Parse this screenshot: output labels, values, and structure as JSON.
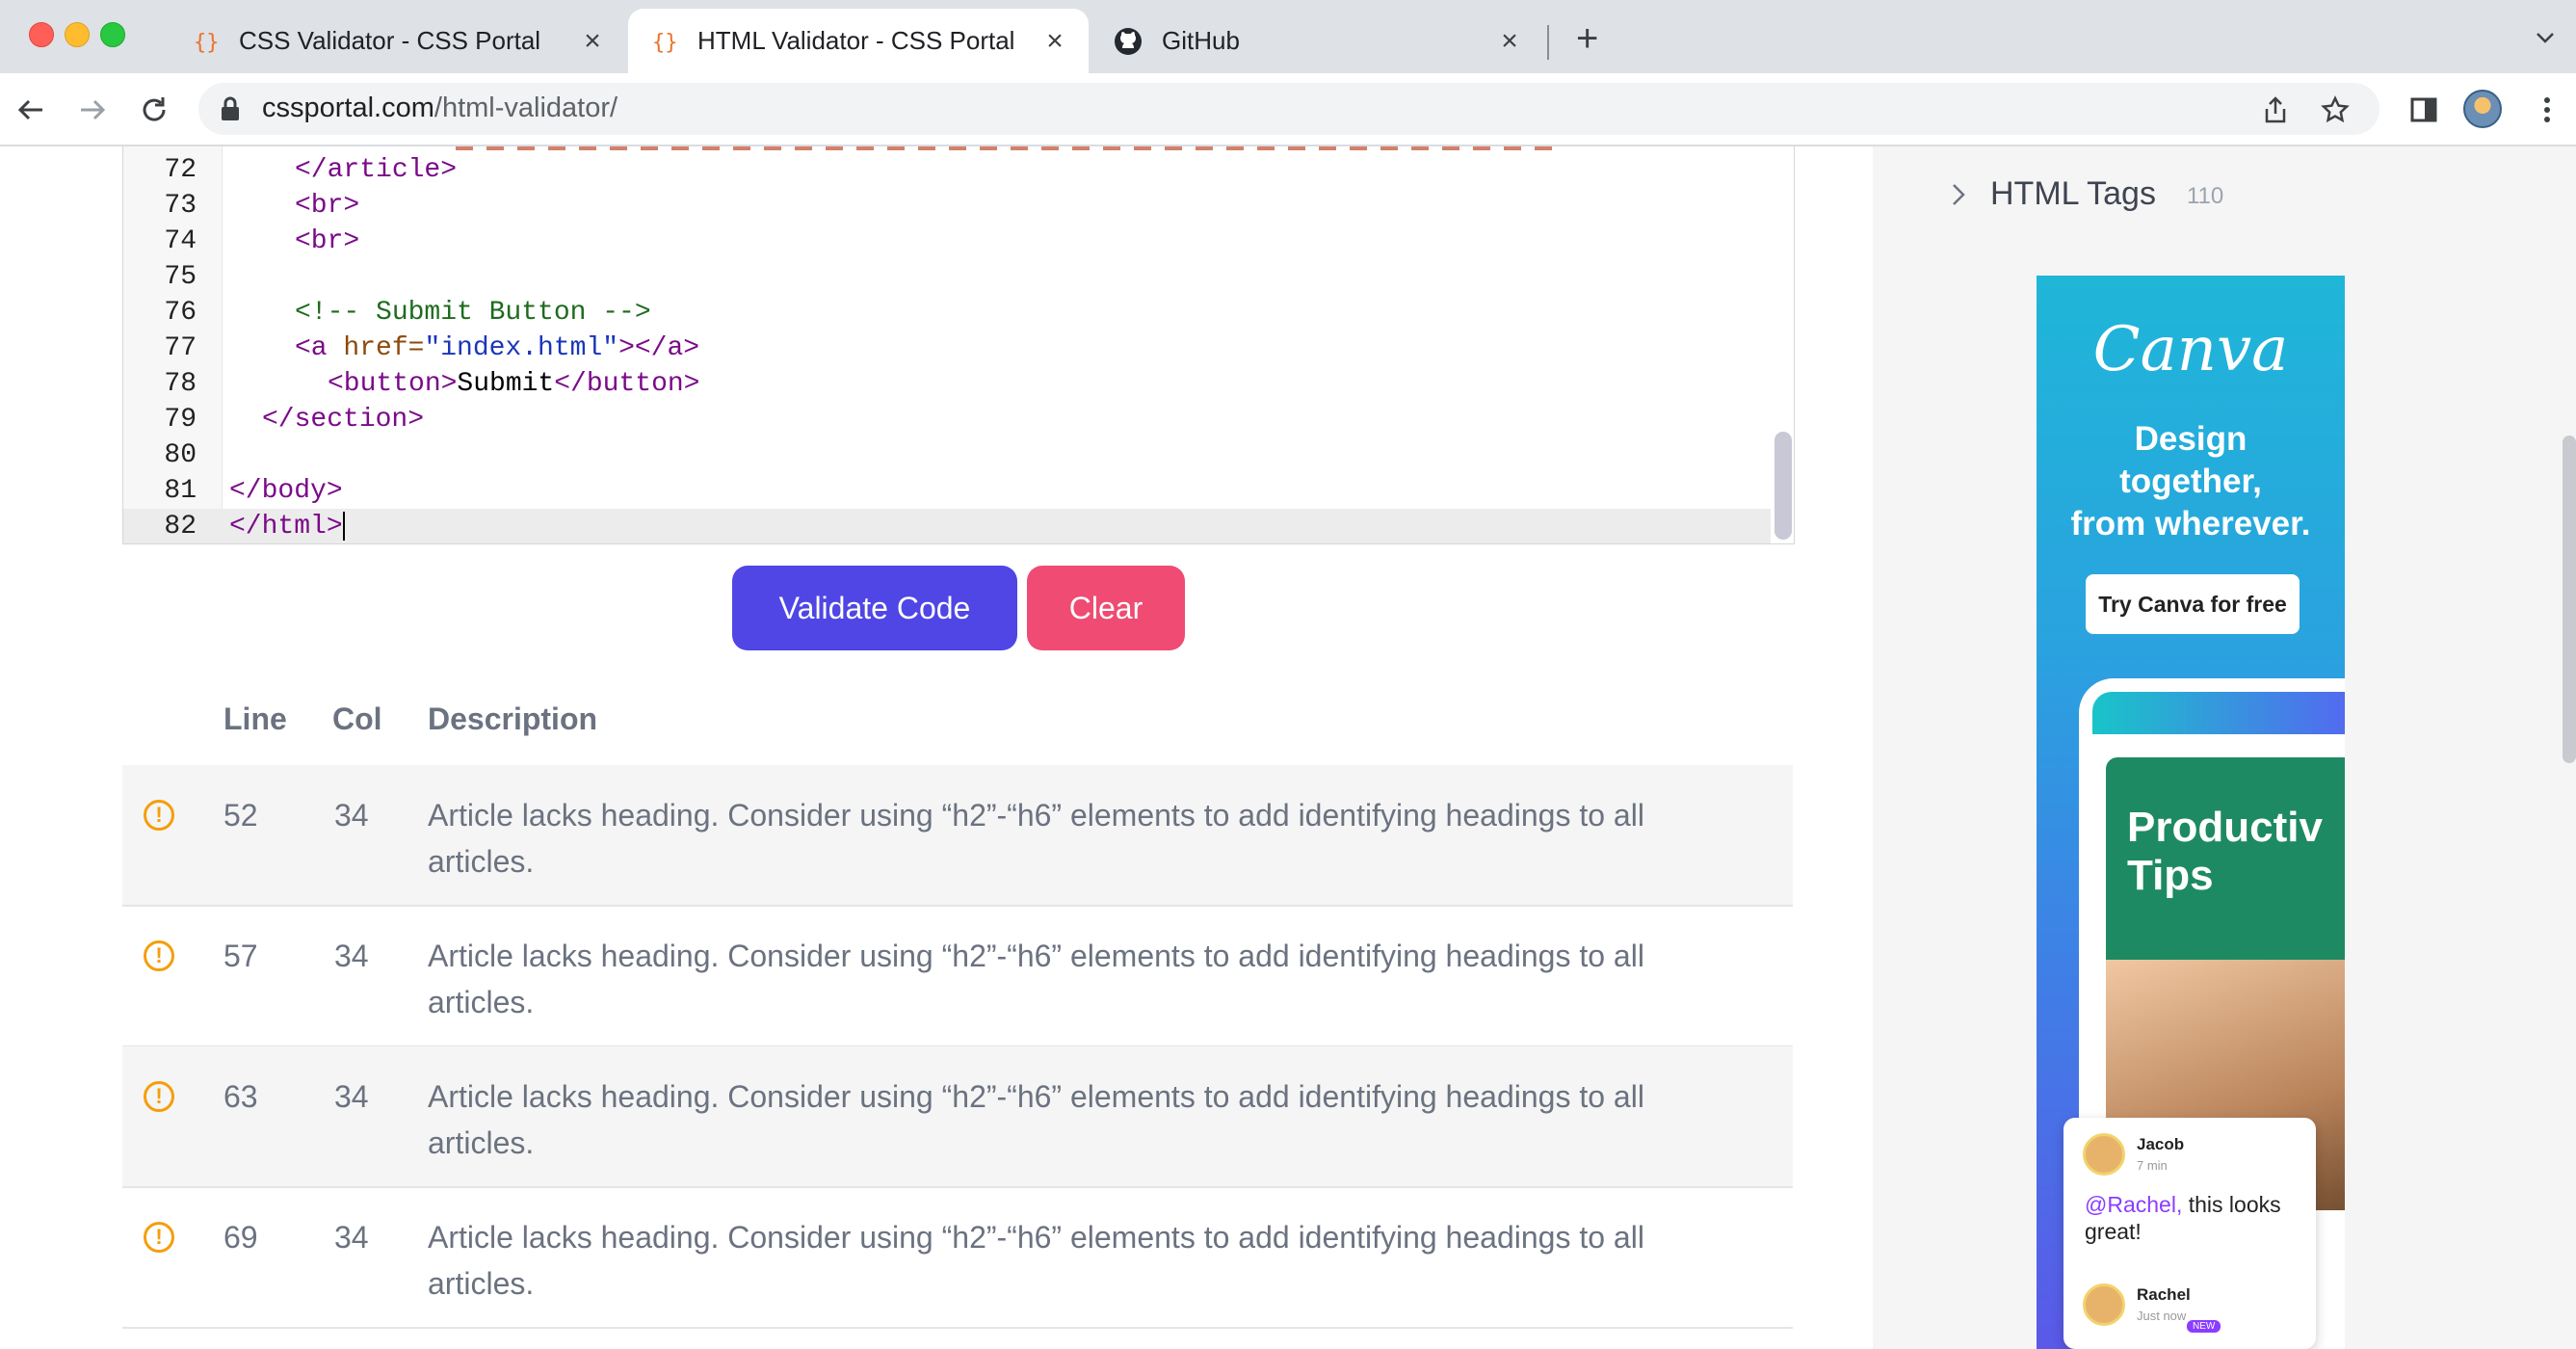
{
  "browser": {
    "tabs": [
      {
        "title": "CSS Validator - CSS Portal",
        "favicon": "css-portal-icon",
        "active": false
      },
      {
        "title": "HTML Validator - CSS Portal",
        "favicon": "css-portal-icon",
        "active": true
      },
      {
        "title": "GitHub",
        "favicon": "github-icon",
        "active": false
      }
    ],
    "url_host": "cssportal.com",
    "url_path": "/html-validator/"
  },
  "editor": {
    "lines": [
      {
        "num": "72",
        "text": "</article>"
      },
      {
        "num": "73",
        "text": "<br>"
      },
      {
        "num": "74",
        "text": "<br>"
      },
      {
        "num": "75",
        "text": ""
      },
      {
        "num": "76",
        "text": "<!-- Submit Button -->"
      },
      {
        "num": "77",
        "text": "<a href=\"index.html\"></a>"
      },
      {
        "num": "78",
        "text": "<button>Submit</button>"
      },
      {
        "num": "79",
        "text": "</section>"
      },
      {
        "num": "80",
        "text": ""
      },
      {
        "num": "81",
        "text": "</body>"
      },
      {
        "num": "82",
        "text": "</html>"
      }
    ]
  },
  "buttons": {
    "validate_label": "Validate Code",
    "clear_label": "Clear"
  },
  "results": {
    "headers": {
      "line": "Line",
      "col": "Col",
      "description": "Description"
    },
    "rows": [
      {
        "line": "52",
        "col": "34",
        "description": "Article lacks heading. Consider using “h2”-“h6” elements to add identifying headings to all articles."
      },
      {
        "line": "57",
        "col": "34",
        "description": "Article lacks heading. Consider using “h2”-“h6” elements to add identifying headings to all articles."
      },
      {
        "line": "63",
        "col": "34",
        "description": "Article lacks heading. Consider using “h2”-“h6” elements to add identifying headings to all articles."
      },
      {
        "line": "69",
        "col": "34",
        "description": "Article lacks heading. Consider using “h2”-“h6” elements to add identifying headings to all articles."
      }
    ]
  },
  "sidebar": {
    "section_label": "HTML Tags",
    "section_count": "110"
  },
  "ad": {
    "logo": "Canva",
    "tagline_1": "Design",
    "tagline_2": "together,",
    "tagline_3": "from wherever.",
    "cta": "Try Canva for free",
    "card_title_1": "Productiv",
    "card_title_2": "Tips",
    "comment_author": "Jacob",
    "comment_time": "7 min",
    "comment_mention": "@Rachel,",
    "comment_text": " this looks great!",
    "reply_author": "Rachel",
    "reply_time": "Just now",
    "reply_badge": "NEW"
  },
  "colors": {
    "validate_button": "#4f46e5",
    "clear_button": "#ef4b73",
    "warning_icon": "#f59e0b"
  }
}
